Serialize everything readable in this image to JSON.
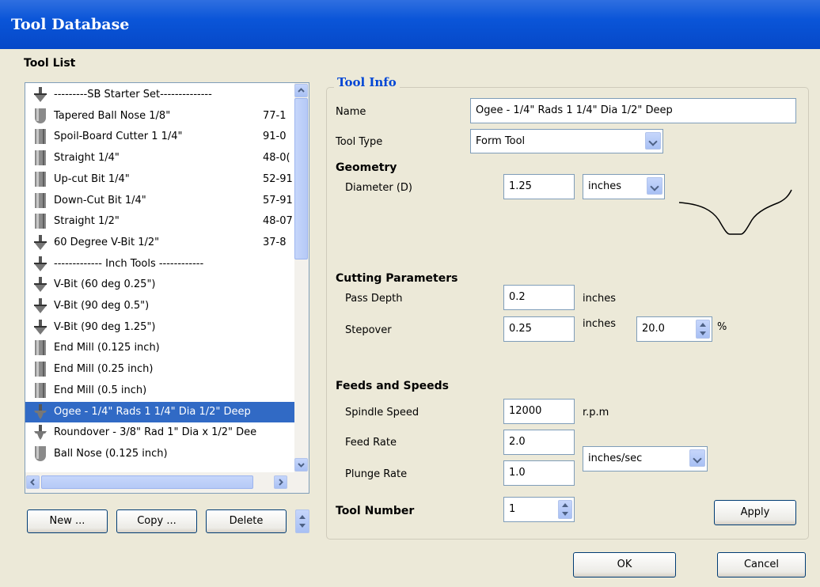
{
  "window": {
    "title": "Tool Database"
  },
  "tool_list": {
    "heading": "Tool List",
    "items": [
      {
        "icon": "v-bit-icon",
        "name": "---------SB Starter Set--------------",
        "code": ""
      },
      {
        "icon": "ball-nose-icon",
        "name": "Tapered Ball Nose 1/8\"",
        "code": "77-1"
      },
      {
        "icon": "end-mill-icon",
        "name": "Spoil-Board Cutter 1 1/4\"",
        "code": "91-0"
      },
      {
        "icon": "end-mill-icon",
        "name": "Straight 1/4\"",
        "code": "48-0("
      },
      {
        "icon": "end-mill-icon",
        "name": "Up-cut Bit 1/4\"",
        "code": "52-91"
      },
      {
        "icon": "end-mill-icon",
        "name": "Down-Cut Bit 1/4\"",
        "code": "57-91"
      },
      {
        "icon": "end-mill-icon",
        "name": "Straight 1/2\"",
        "code": "48-07"
      },
      {
        "icon": "v-bit-icon",
        "name": "60 Degree V-Bit 1/2\"",
        "code": "37-8"
      },
      {
        "icon": "v-bit-icon",
        "name": "------------- Inch Tools ------------",
        "code": ""
      },
      {
        "icon": "v-bit-icon",
        "name": "V-Bit (60 deg 0.25\")",
        "code": ""
      },
      {
        "icon": "v-bit-icon",
        "name": "V-Bit (90 deg 0.5\")",
        "code": ""
      },
      {
        "icon": "v-bit-icon",
        "name": "V-Bit (90 deg 1.25\")",
        "code": ""
      },
      {
        "icon": "end-mill-icon",
        "name": "End Mill (0.125 inch)",
        "code": ""
      },
      {
        "icon": "end-mill-icon",
        "name": "End Mill (0.25 inch)",
        "code": ""
      },
      {
        "icon": "end-mill-icon",
        "name": "End Mill (0.5 inch)",
        "code": ""
      },
      {
        "icon": "form-tool-icon",
        "name": "Ogee - 1/4\" Rads 1 1/4\" Dia 1/2\" Deep",
        "code": "",
        "selected": true
      },
      {
        "icon": "form-tool-icon",
        "name": "Roundover - 3/8\" Rad 1\" Dia x 1/2\" Dee",
        "code": ""
      },
      {
        "icon": "ball-nose-icon",
        "name": "Ball Nose (0.125 inch)",
        "code": ""
      }
    ],
    "buttons": {
      "new": "New ...",
      "copy": "Copy ...",
      "delete": "Delete"
    }
  },
  "tool_info": {
    "legend": "Tool Info",
    "name_label": "Name",
    "name_value": "Ogee - 1/4\" Rads 1 1/4\" Dia 1/2\" Deep",
    "type_label": "Tool Type",
    "type_value": "Form Tool",
    "geometry": {
      "heading": "Geometry",
      "diameter_label": "Diameter (D)",
      "diameter_value": "1.25",
      "units_value": "inches"
    },
    "cutting": {
      "heading": "Cutting Parameters",
      "pass_depth_label": "Pass Depth",
      "pass_depth_value": "0.2",
      "pass_depth_unit": "inches",
      "stepover_label": "Stepover",
      "stepover_value": "0.25",
      "stepover_unit": "inches",
      "stepover_percent": "20.0",
      "percent_sign": "%"
    },
    "feeds": {
      "heading": "Feeds and Speeds",
      "spindle_label": "Spindle Speed",
      "spindle_value": "12000",
      "spindle_unit": "r.p.m",
      "feed_label": "Feed Rate",
      "feed_value": "2.0",
      "plunge_label": "Plunge Rate",
      "plunge_value": "1.0",
      "rate_units": "inches/sec"
    },
    "tool_number_label": "Tool Number",
    "tool_number_value": "1",
    "apply": "Apply"
  },
  "dialog": {
    "ok": "OK",
    "cancel": "Cancel"
  }
}
